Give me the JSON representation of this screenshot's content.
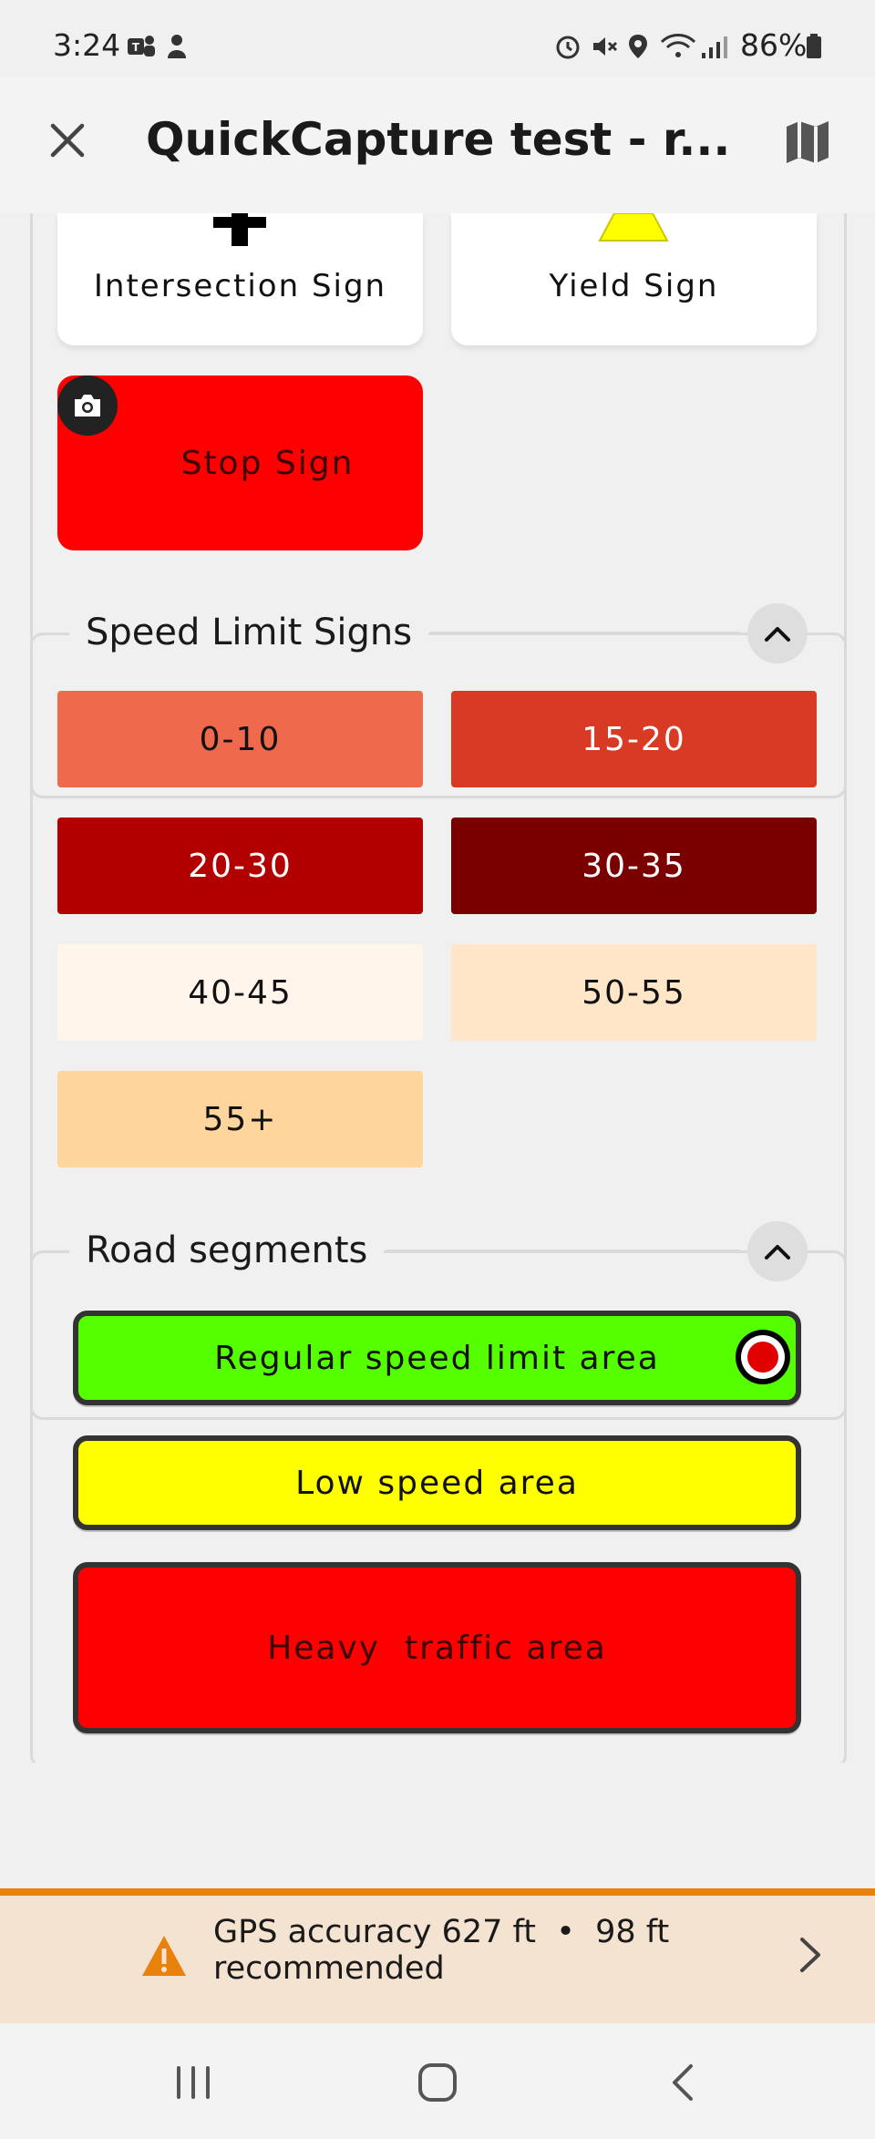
{
  "status_bar": {
    "time": "3:24",
    "battery": "86%",
    "icons_left": [
      "teams-icon",
      "notification-icon"
    ],
    "icons_right": [
      "alarm-icon",
      "mute-icon",
      "location-icon",
      "wifi-icon",
      "signal-icon",
      "battery-icon"
    ]
  },
  "app_bar": {
    "title": "QuickCapture test - r...",
    "close_icon": "close-icon",
    "map_icon": "map-icon"
  },
  "sign_group": {
    "tiles": [
      {
        "label": "Intersection Sign",
        "icon": "intersection-sign-icon"
      },
      {
        "label": "Yield Sign",
        "icon": "yield-sign-icon"
      }
    ],
    "stop_tile": {
      "label": "Stop Sign",
      "icon": "camera-icon",
      "color": "#ff0000"
    }
  },
  "speed_group": {
    "title": "Speed Limit Signs",
    "tiles": [
      {
        "label": "0-10",
        "color": "#ef6a4c",
        "text_color": "#111111"
      },
      {
        "label": "15-20",
        "color": "#d93a24",
        "text_color": "#ffffff"
      },
      {
        "label": "20-30",
        "color": "#b20000",
        "text_color": "#ffffff"
      },
      {
        "label": "30-35",
        "color": "#7a0000",
        "text_color": "#ffffff"
      },
      {
        "label": "40-45",
        "color": "#fff5ea",
        "text_color": "#111111"
      },
      {
        "label": "50-55",
        "color": "#ffe6c8",
        "text_color": "#111111"
      },
      {
        "label": "55+",
        "color": "#ffd59e",
        "text_color": "#111111"
      }
    ]
  },
  "road_group": {
    "title": "Road segments",
    "buttons": [
      {
        "label": "Regular speed limit area",
        "color": "#55ff00",
        "recording": true
      },
      {
        "label": "Low speed area",
        "color": "#ffff00",
        "recording": false
      },
      {
        "label": "Heavy  traffic area",
        "color": "#ff0000",
        "recording": false
      }
    ]
  },
  "gps": {
    "line1": "GPS accuracy 627 ft  •  98 ft",
    "line2": "recommended",
    "warning_color": "#e8820c"
  },
  "nav": {
    "recents": "recents-icon",
    "home": "home-icon",
    "back": "back-icon"
  }
}
